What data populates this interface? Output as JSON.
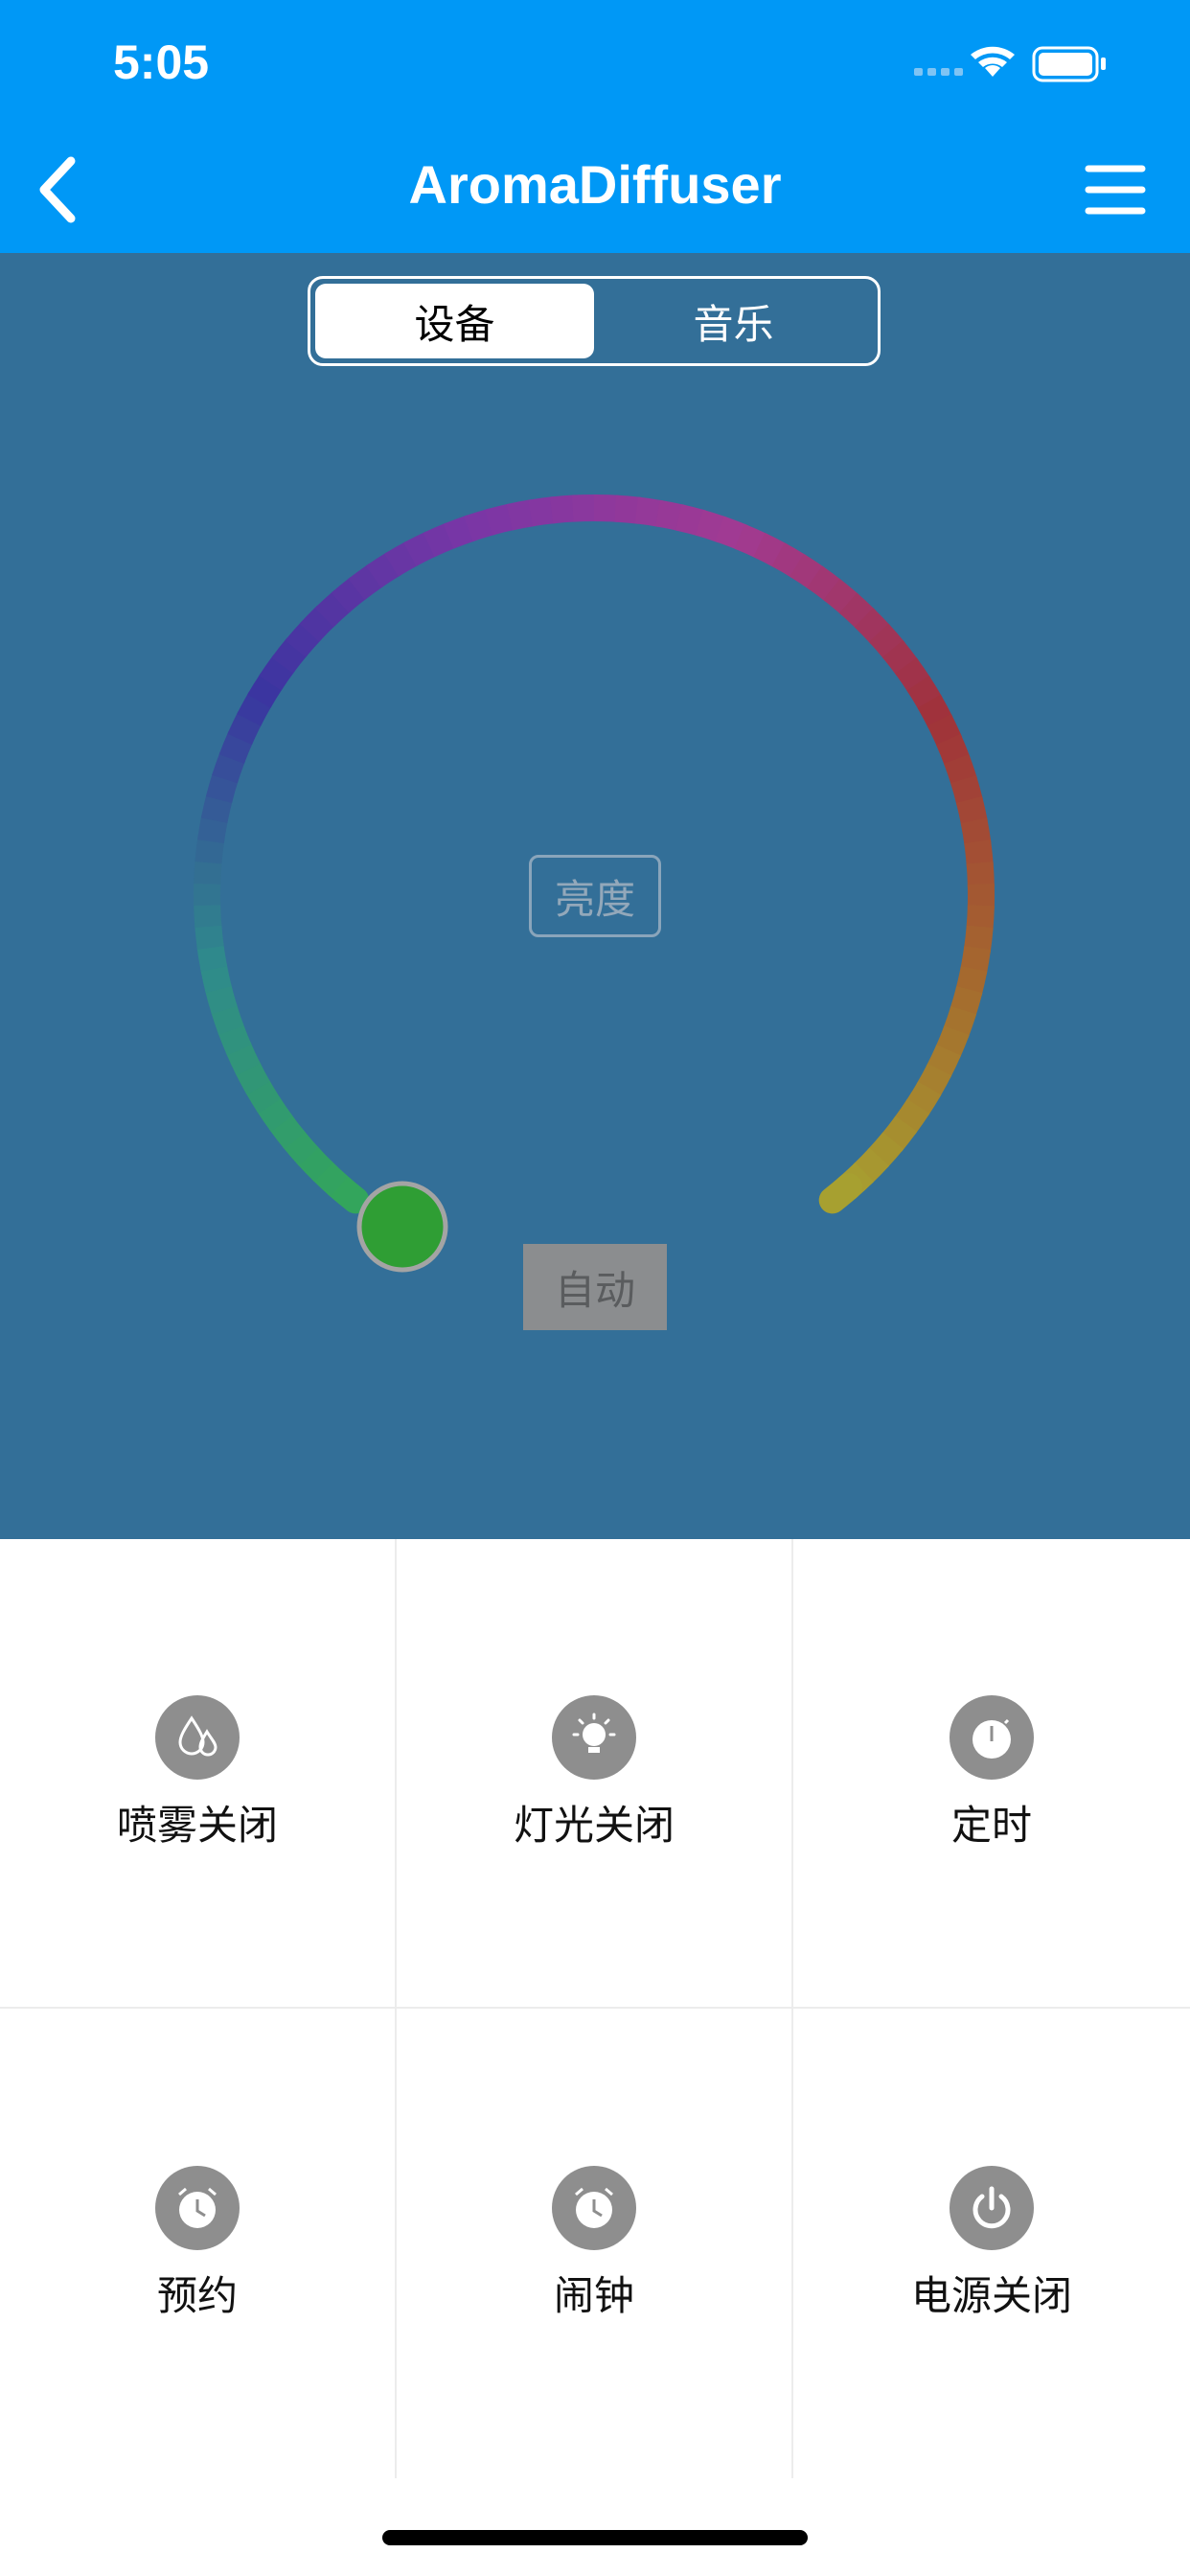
{
  "status_bar": {
    "time": "5:05"
  },
  "nav": {
    "title": "AromaDiffuser",
    "back_icon": "chevron-left-icon",
    "menu_icon": "hamburger-menu-icon"
  },
  "tabs": [
    {
      "label": "设备",
      "selected": true
    },
    {
      "label": "音乐",
      "selected": false
    }
  ],
  "dial": {
    "center_label": "亮度",
    "auto_button": "自动",
    "colors": {
      "green": "#33a55c",
      "teal": "#2f8a8c",
      "indigo": "#3a35a0",
      "purple": "#7a36a6",
      "magenta": "#a13a92",
      "red": "#a0323a",
      "orange": "#a56a2e",
      "yellow": "#a7a530",
      "knob": "#2f9e34"
    }
  },
  "controls": [
    {
      "label": "喷雾关闭",
      "icon": "water-drops-icon"
    },
    {
      "label": "灯光关闭",
      "icon": "light-bulb-icon"
    },
    {
      "label": "定时",
      "icon": "timer-icon"
    },
    {
      "label": "预约",
      "icon": "alarm-clock-icon"
    },
    {
      "label": "闹钟",
      "icon": "alarm-clock-icon"
    },
    {
      "label": "电源关闭",
      "icon": "power-icon"
    }
  ],
  "theme": {
    "nav_blue": "#0098f6",
    "panel_blue": "#336f98",
    "icon_gray": "#8e8e8e"
  }
}
